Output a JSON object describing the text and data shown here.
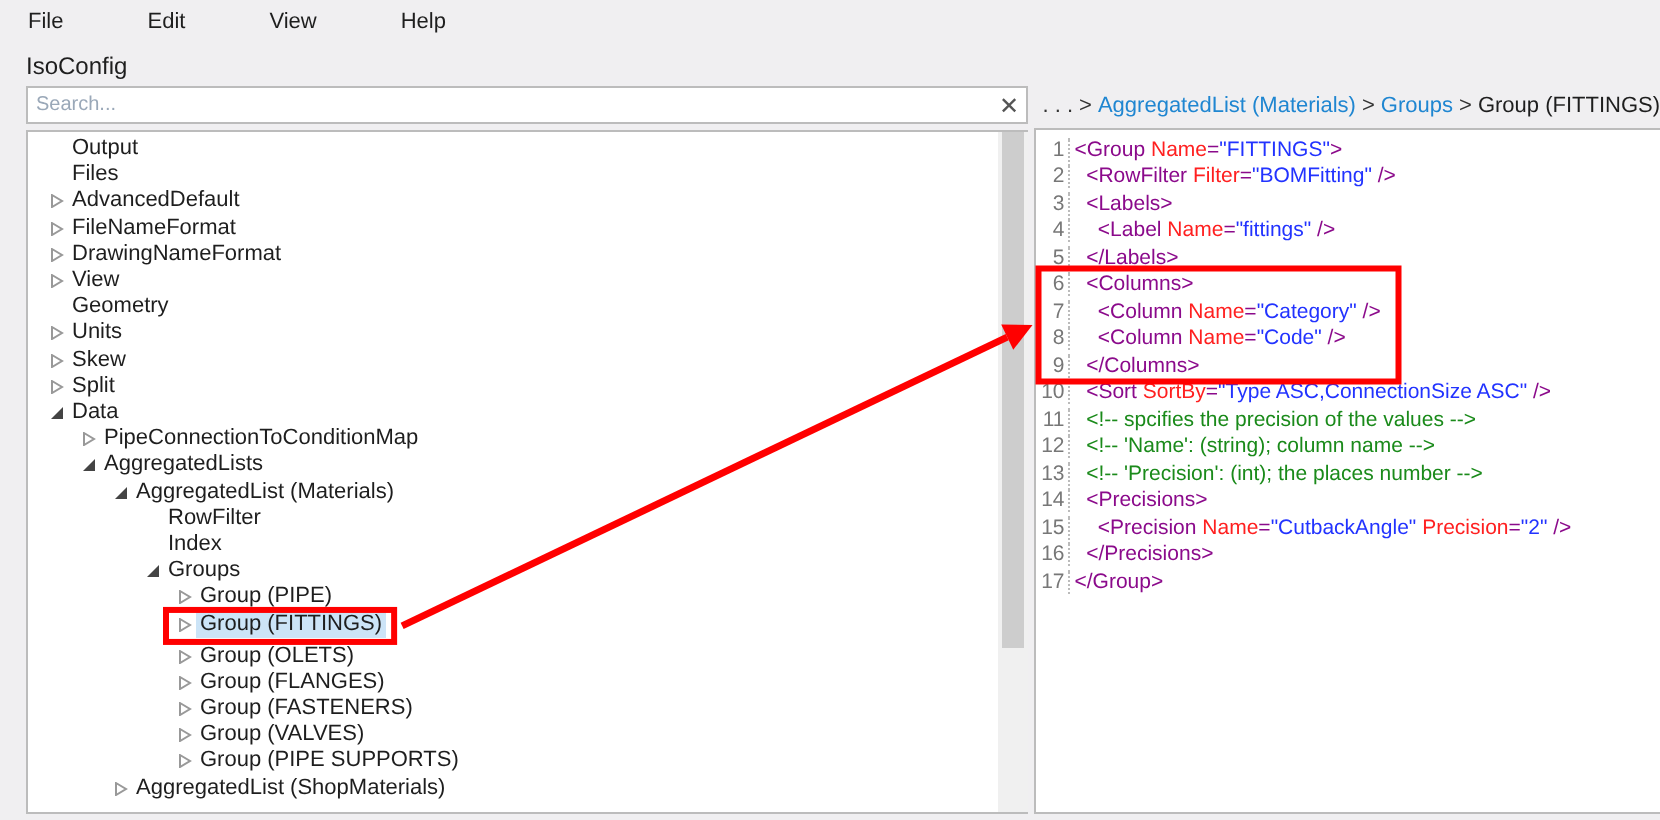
{
  "menu": [
    "File",
    "Edit",
    "View",
    "Help"
  ],
  "app_title": "IsoConfig",
  "search": {
    "placeholder": "Search...",
    "clear": "✕"
  },
  "tree": [
    {
      "label": "Output",
      "selected": false
    },
    {
      "label": "Files",
      "selected": false
    },
    {
      "label": "AdvancedDefault",
      "expanded": false,
      "selected": false
    },
    {
      "label": "FileNameFormat",
      "expanded": false,
      "selected": false
    },
    {
      "label": "DrawingNameFormat",
      "expanded": false,
      "selected": false
    },
    {
      "label": "View",
      "expanded": false,
      "selected": false
    },
    {
      "label": "Geometry",
      "selected": false
    },
    {
      "label": "Units",
      "expanded": false,
      "selected": false
    },
    {
      "label": "Skew",
      "expanded": false,
      "selected": false
    },
    {
      "label": "Split",
      "expanded": false,
      "selected": false
    },
    {
      "label": "Data",
      "expanded": true,
      "selected": false,
      "children": [
        {
          "label": "PipeConnectionToConditionMap",
          "expanded": false,
          "selected": false
        },
        {
          "label": "AggregatedLists",
          "expanded": true,
          "selected": false,
          "children": [
            {
              "label": "AggregatedList (Materials)",
              "expanded": true,
              "selected": false,
              "children": [
                {
                  "label": "RowFilter",
                  "selected": false
                },
                {
                  "label": "Index",
                  "selected": false
                },
                {
                  "label": "Groups",
                  "expanded": true,
                  "selected": false,
                  "children": [
                    {
                      "label": "Group (PIPE)",
                      "expanded": false,
                      "selected": false
                    },
                    {
                      "label": "Group (FITTINGS)",
                      "expanded": false,
                      "selected": true
                    },
                    {
                      "label": "Group (OLETS)",
                      "expanded": false,
                      "selected": false
                    },
                    {
                      "label": "Group (FLANGES)",
                      "expanded": false,
                      "selected": false
                    },
                    {
                      "label": "Group (FASTENERS)",
                      "expanded": false,
                      "selected": false
                    },
                    {
                      "label": "Group (VALVES)",
                      "expanded": false,
                      "selected": false
                    },
                    {
                      "label": "Group (PIPE SUPPORTS)",
                      "expanded": false,
                      "selected": false
                    }
                  ]
                }
              ]
            },
            {
              "label": "AggregatedList (ShopMaterials)",
              "expanded": false,
              "selected": false
            }
          ]
        }
      ]
    }
  ],
  "breadcrumb": [
    {
      "kind": "ellipsis",
      "text": ". . ."
    },
    {
      "kind": "sep",
      "text": ">"
    },
    {
      "kind": "link",
      "text": "AggregatedList (Materials)"
    },
    {
      "kind": "sep",
      "text": ">"
    },
    {
      "kind": "link",
      "text": "Groups"
    },
    {
      "kind": "sep",
      "text": ">"
    },
    {
      "kind": "current",
      "text": "Group (FITTINGS)"
    }
  ],
  "code": [
    {
      "number": "1",
      "tokens": [
        {
          "kind": "tag",
          "text": "<Group "
        },
        {
          "kind": "attr",
          "text": "Name"
        },
        {
          "kind": "tag",
          "text": "="
        },
        {
          "kind": "value",
          "text": "\"FITTINGS\""
        },
        {
          "kind": "tag",
          "text": ">"
        }
      ]
    },
    {
      "number": "2",
      "tokens": [
        {
          "kind": "tag",
          "text": "  <RowFilter "
        },
        {
          "kind": "attr",
          "text": "Filter"
        },
        {
          "kind": "tag",
          "text": "="
        },
        {
          "kind": "value",
          "text": "\"BOMFitting\""
        },
        {
          "kind": "tag",
          "text": " />"
        }
      ]
    },
    {
      "number": "3",
      "tokens": [
        {
          "kind": "tag",
          "text": "  <Labels>"
        }
      ]
    },
    {
      "number": "4",
      "tokens": [
        {
          "kind": "tag",
          "text": "    <Label "
        },
        {
          "kind": "attr",
          "text": "Name"
        },
        {
          "kind": "tag",
          "text": "="
        },
        {
          "kind": "value",
          "text": "\"fittings\""
        },
        {
          "kind": "tag",
          "text": " />"
        }
      ]
    },
    {
      "number": "5",
      "tokens": [
        {
          "kind": "tag",
          "text": "  </Labels>"
        }
      ]
    },
    {
      "number": "6",
      "tokens": [
        {
          "kind": "tag",
          "text": "  <Columns>"
        }
      ]
    },
    {
      "number": "7",
      "tokens": [
        {
          "kind": "tag",
          "text": "    <Column "
        },
        {
          "kind": "attr",
          "text": "Name"
        },
        {
          "kind": "tag",
          "text": "="
        },
        {
          "kind": "value",
          "text": "\"Category\""
        },
        {
          "kind": "tag",
          "text": " />"
        }
      ]
    },
    {
      "number": "8",
      "tokens": [
        {
          "kind": "tag",
          "text": "    <Column "
        },
        {
          "kind": "attr",
          "text": "Name"
        },
        {
          "kind": "tag",
          "text": "="
        },
        {
          "kind": "value",
          "text": "\"Code\""
        },
        {
          "kind": "tag",
          "text": " />"
        }
      ]
    },
    {
      "number": "9",
      "tokens": [
        {
          "kind": "tag",
          "text": "  </Columns>"
        }
      ]
    },
    {
      "number": "10",
      "tokens": [
        {
          "kind": "tag",
          "text": "  <Sort "
        },
        {
          "kind": "attr",
          "text": "SortBy"
        },
        {
          "kind": "tag",
          "text": "="
        },
        {
          "kind": "value",
          "text": "\"Type ASC,ConnectionSize ASC\""
        },
        {
          "kind": "tag",
          "text": " />"
        }
      ]
    },
    {
      "number": "11",
      "tokens": [
        {
          "kind": "comment",
          "text": "  <!-- spcifies the precision of the values -->"
        }
      ]
    },
    {
      "number": "12",
      "tokens": [
        {
          "kind": "comment",
          "text": "  <!-- 'Name': (string); column name -->"
        }
      ]
    },
    {
      "number": "13",
      "tokens": [
        {
          "kind": "comment",
          "text": "  <!-- 'Precision': (int); the places number -->"
        }
      ]
    },
    {
      "number": "14",
      "tokens": [
        {
          "kind": "tag",
          "text": "  <Precisions>"
        }
      ]
    },
    {
      "number": "15",
      "tokens": [
        {
          "kind": "tag",
          "text": "    <Precision "
        },
        {
          "kind": "attr",
          "text": "Name"
        },
        {
          "kind": "tag",
          "text": "="
        },
        {
          "kind": "value",
          "text": "\"CutbackAngle\""
        },
        {
          "kind": "attr",
          "text": " Precision"
        },
        {
          "kind": "tag",
          "text": "="
        },
        {
          "kind": "value",
          "text": "\"2\""
        },
        {
          "kind": "tag",
          "text": " />"
        }
      ]
    },
    {
      "number": "16",
      "tokens": [
        {
          "kind": "tag",
          "text": "  </Precisions>"
        }
      ]
    },
    {
      "number": "17",
      "tokens": [
        {
          "kind": "tag",
          "text": "</Group>"
        }
      ]
    }
  ]
}
